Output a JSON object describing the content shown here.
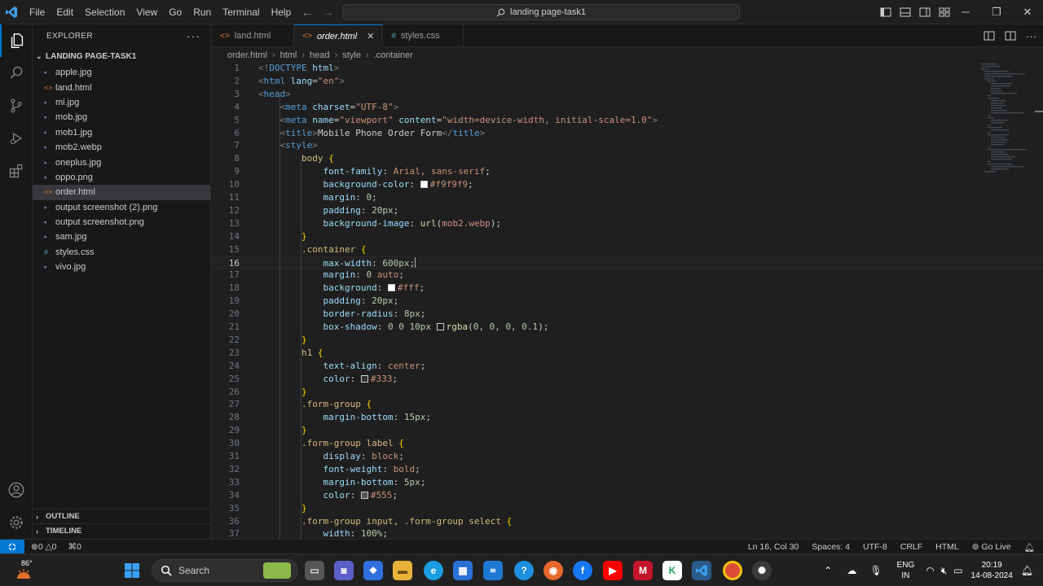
{
  "window": {
    "menu": [
      "File",
      "Edit",
      "Selection",
      "View",
      "Go",
      "Run",
      "Terminal",
      "Help"
    ],
    "command_center": "landing page-task1"
  },
  "explorer": {
    "title": "EXPLORER",
    "folder": "LANDING PAGE-TASK1",
    "files": [
      {
        "name": "apple.jpg",
        "type": "image"
      },
      {
        "name": "land.html",
        "type": "html"
      },
      {
        "name": "mi.jpg",
        "type": "image"
      },
      {
        "name": "mob.jpg",
        "type": "image"
      },
      {
        "name": "mob1.jpg",
        "type": "image"
      },
      {
        "name": "mob2.webp",
        "type": "image"
      },
      {
        "name": "oneplus.jpg",
        "type": "image"
      },
      {
        "name": "oppo.png",
        "type": "image"
      },
      {
        "name": "order.html",
        "type": "html",
        "selected": true
      },
      {
        "name": "output screenshot (2).png",
        "type": "image"
      },
      {
        "name": "output screenshot.png",
        "type": "image"
      },
      {
        "name": "sam.jpg",
        "type": "image"
      },
      {
        "name": "styles.css",
        "type": "css"
      },
      {
        "name": "vivo.jpg",
        "type": "image"
      }
    ],
    "outline": "OUTLINE",
    "timeline": "TIMELINE"
  },
  "tabs": [
    {
      "label": "land.html",
      "type": "html",
      "active": false
    },
    {
      "label": "order.html",
      "type": "html",
      "active": true
    },
    {
      "label": "styles.css",
      "type": "css",
      "active": false
    }
  ],
  "breadcrumb": [
    "order.html",
    "html",
    "head",
    "style",
    ".container"
  ],
  "editor": {
    "current_line": 16,
    "lines": [
      {
        "n": 1,
        "t": [
          [
            "t-gray",
            "<!"
          ],
          [
            "t-tag",
            "DOCTYPE"
          ],
          [
            "t-text",
            " "
          ],
          [
            "t-attr",
            "html"
          ],
          [
            "t-gray",
            ">"
          ]
        ]
      },
      {
        "n": 2,
        "t": [
          [
            "t-gray",
            "<"
          ],
          [
            "t-tag",
            "html"
          ],
          [
            "t-text",
            " "
          ],
          [
            "t-attr",
            "lang"
          ],
          [
            "t-text",
            "="
          ],
          [
            "t-str",
            "\"en\""
          ],
          [
            "t-gray",
            ">"
          ]
        ]
      },
      {
        "n": 3,
        "t": [
          [
            "t-gray",
            "<"
          ],
          [
            "t-tag",
            "head"
          ],
          [
            "t-gray",
            ">"
          ]
        ]
      },
      {
        "n": 4,
        "t": [
          [
            "t-text",
            "    "
          ],
          [
            "t-gray",
            "<"
          ],
          [
            "t-tag",
            "meta"
          ],
          [
            "t-text",
            " "
          ],
          [
            "t-attr",
            "charset"
          ],
          [
            "t-text",
            "="
          ],
          [
            "t-str",
            "\"UTF-8\""
          ],
          [
            "t-gray",
            ">"
          ]
        ]
      },
      {
        "n": 5,
        "t": [
          [
            "t-text",
            "    "
          ],
          [
            "t-gray",
            "<"
          ],
          [
            "t-tag",
            "meta"
          ],
          [
            "t-text",
            " "
          ],
          [
            "t-attr",
            "name"
          ],
          [
            "t-text",
            "="
          ],
          [
            "t-str",
            "\"viewport\""
          ],
          [
            "t-text",
            " "
          ],
          [
            "t-attr",
            "content"
          ],
          [
            "t-text",
            "="
          ],
          [
            "t-str",
            "\"width=device-width, initial-scale=1.0\""
          ],
          [
            "t-gray",
            ">"
          ]
        ]
      },
      {
        "n": 6,
        "t": [
          [
            "t-text",
            "    "
          ],
          [
            "t-gray",
            "<"
          ],
          [
            "t-tag",
            "title"
          ],
          [
            "t-gray",
            ">"
          ],
          [
            "t-text",
            "Mobile Phone Order Form"
          ],
          [
            "t-gray",
            "</"
          ],
          [
            "t-tag",
            "title"
          ],
          [
            "t-gray",
            ">"
          ]
        ]
      },
      {
        "n": 7,
        "t": [
          [
            "t-text",
            "    "
          ],
          [
            "t-gray",
            "<"
          ],
          [
            "t-tag",
            "style"
          ],
          [
            "t-gray",
            ">"
          ]
        ]
      },
      {
        "n": 8,
        "t": [
          [
            "t-text",
            "        "
          ],
          [
            "t-sel",
            "body"
          ],
          [
            "t-text",
            " "
          ],
          [
            "t-brace",
            "{"
          ]
        ]
      },
      {
        "n": 9,
        "t": [
          [
            "t-text",
            "            "
          ],
          [
            "t-prop",
            "font-family"
          ],
          [
            "t-punc",
            ": "
          ],
          [
            "t-val",
            "Arial, sans-serif"
          ],
          [
            "t-punc",
            ";"
          ]
        ]
      },
      {
        "n": 10,
        "t": [
          [
            "t-text",
            "            "
          ],
          [
            "t-prop",
            "background-color"
          ],
          [
            "t-punc",
            ": "
          ],
          [
            "swatch",
            "#f9f9f9"
          ],
          [
            "t-val",
            "#f9f9f9"
          ],
          [
            "t-punc",
            ";"
          ]
        ]
      },
      {
        "n": 11,
        "t": [
          [
            "t-text",
            "            "
          ],
          [
            "t-prop",
            "margin"
          ],
          [
            "t-punc",
            ": "
          ],
          [
            "t-num",
            "0"
          ],
          [
            "t-punc",
            ";"
          ]
        ]
      },
      {
        "n": 12,
        "t": [
          [
            "t-text",
            "            "
          ],
          [
            "t-prop",
            "padding"
          ],
          [
            "t-punc",
            ": "
          ],
          [
            "t-num",
            "20px"
          ],
          [
            "t-punc",
            ";"
          ]
        ]
      },
      {
        "n": 13,
        "t": [
          [
            "t-text",
            "            "
          ],
          [
            "t-prop",
            "background-image"
          ],
          [
            "t-punc",
            ": "
          ],
          [
            "t-fn",
            "url"
          ],
          [
            "t-punc",
            "("
          ],
          [
            "t-val",
            "mob2.webp"
          ],
          [
            "t-punc",
            ");"
          ]
        ]
      },
      {
        "n": 14,
        "t": [
          [
            "t-text",
            "        "
          ],
          [
            "t-brace",
            "}"
          ]
        ]
      },
      {
        "n": 15,
        "t": [
          [
            "t-text",
            "        "
          ],
          [
            "t-sel",
            ".container"
          ],
          [
            "t-text",
            " "
          ],
          [
            "t-brace",
            "{"
          ]
        ]
      },
      {
        "n": 16,
        "t": [
          [
            "t-text",
            "            "
          ],
          [
            "t-prop",
            "max-width"
          ],
          [
            "t-punc",
            ": "
          ],
          [
            "t-num",
            "600px"
          ],
          [
            "t-punc",
            ";"
          ],
          [
            "caret",
            ""
          ]
        ]
      },
      {
        "n": 17,
        "t": [
          [
            "t-text",
            "            "
          ],
          [
            "t-prop",
            "margin"
          ],
          [
            "t-punc",
            ": "
          ],
          [
            "t-num",
            "0"
          ],
          [
            "t-text",
            " "
          ],
          [
            "t-val",
            "auto"
          ],
          [
            "t-punc",
            ";"
          ]
        ]
      },
      {
        "n": 18,
        "t": [
          [
            "t-text",
            "            "
          ],
          [
            "t-prop",
            "background"
          ],
          [
            "t-punc",
            ": "
          ],
          [
            "swatch",
            "#ffffff"
          ],
          [
            "t-val",
            "#fff"
          ],
          [
            "t-punc",
            ";"
          ]
        ]
      },
      {
        "n": 19,
        "t": [
          [
            "t-text",
            "            "
          ],
          [
            "t-prop",
            "padding"
          ],
          [
            "t-punc",
            ": "
          ],
          [
            "t-num",
            "20px"
          ],
          [
            "t-punc",
            ";"
          ]
        ]
      },
      {
        "n": 20,
        "t": [
          [
            "t-text",
            "            "
          ],
          [
            "t-prop",
            "border-radius"
          ],
          [
            "t-punc",
            ": "
          ],
          [
            "t-num",
            "8px"
          ],
          [
            "t-punc",
            ";"
          ]
        ]
      },
      {
        "n": 21,
        "t": [
          [
            "t-text",
            "            "
          ],
          [
            "t-prop",
            "box-shadow"
          ],
          [
            "t-punc",
            ": "
          ],
          [
            "t-num",
            "0 0 10px"
          ],
          [
            "t-text",
            " "
          ],
          [
            "swatch",
            "rgba(0,0,0,0.1)"
          ],
          [
            "t-fn",
            "rgba"
          ],
          [
            "t-punc",
            "("
          ],
          [
            "t-num",
            "0, 0, 0, 0.1"
          ],
          [
            "t-punc",
            ");"
          ]
        ]
      },
      {
        "n": 22,
        "t": [
          [
            "t-text",
            "        "
          ],
          [
            "t-brace",
            "}"
          ]
        ]
      },
      {
        "n": 23,
        "t": [
          [
            "t-text",
            "        "
          ],
          [
            "t-sel",
            "h1"
          ],
          [
            "t-text",
            " "
          ],
          [
            "t-brace",
            "{"
          ]
        ]
      },
      {
        "n": 24,
        "t": [
          [
            "t-text",
            "            "
          ],
          [
            "t-prop",
            "text-align"
          ],
          [
            "t-punc",
            ": "
          ],
          [
            "t-val",
            "center"
          ],
          [
            "t-punc",
            ";"
          ]
        ]
      },
      {
        "n": 25,
        "t": [
          [
            "t-text",
            "            "
          ],
          [
            "t-prop",
            "color"
          ],
          [
            "t-punc",
            ": "
          ],
          [
            "swatch",
            "#333333"
          ],
          [
            "t-val",
            "#333"
          ],
          [
            "t-punc",
            ";"
          ]
        ]
      },
      {
        "n": 26,
        "t": [
          [
            "t-text",
            "        "
          ],
          [
            "t-brace",
            "}"
          ]
        ]
      },
      {
        "n": 27,
        "t": [
          [
            "t-text",
            "        "
          ],
          [
            "t-sel",
            ".form-group"
          ],
          [
            "t-text",
            " "
          ],
          [
            "t-brace",
            "{"
          ]
        ]
      },
      {
        "n": 28,
        "t": [
          [
            "t-text",
            "            "
          ],
          [
            "t-prop",
            "margin-bottom"
          ],
          [
            "t-punc",
            ": "
          ],
          [
            "t-num",
            "15px"
          ],
          [
            "t-punc",
            ";"
          ]
        ]
      },
      {
        "n": 29,
        "t": [
          [
            "t-text",
            "        "
          ],
          [
            "t-brace",
            "}"
          ]
        ]
      },
      {
        "n": 30,
        "t": [
          [
            "t-text",
            "        "
          ],
          [
            "t-sel",
            ".form-group label"
          ],
          [
            "t-text",
            " "
          ],
          [
            "t-brace",
            "{"
          ]
        ]
      },
      {
        "n": 31,
        "t": [
          [
            "t-text",
            "            "
          ],
          [
            "t-prop",
            "display"
          ],
          [
            "t-punc",
            ": "
          ],
          [
            "t-val",
            "block"
          ],
          [
            "t-punc",
            ";"
          ]
        ]
      },
      {
        "n": 32,
        "t": [
          [
            "t-text",
            "            "
          ],
          [
            "t-prop",
            "font-weight"
          ],
          [
            "t-punc",
            ": "
          ],
          [
            "t-val",
            "bold"
          ],
          [
            "t-punc",
            ";"
          ]
        ]
      },
      {
        "n": 33,
        "t": [
          [
            "t-text",
            "            "
          ],
          [
            "t-prop",
            "margin-bottom"
          ],
          [
            "t-punc",
            ": "
          ],
          [
            "t-num",
            "5px"
          ],
          [
            "t-punc",
            ";"
          ]
        ]
      },
      {
        "n": 34,
        "t": [
          [
            "t-text",
            "            "
          ],
          [
            "t-prop",
            "color"
          ],
          [
            "t-punc",
            ": "
          ],
          [
            "swatch",
            "#555555"
          ],
          [
            "t-val",
            "#555"
          ],
          [
            "t-punc",
            ";"
          ]
        ]
      },
      {
        "n": 35,
        "t": [
          [
            "t-text",
            "        "
          ],
          [
            "t-brace",
            "}"
          ]
        ]
      },
      {
        "n": 36,
        "t": [
          [
            "t-text",
            "        "
          ],
          [
            "t-sel",
            ".form-group input, .form-group select"
          ],
          [
            "t-text",
            " "
          ],
          [
            "t-brace",
            "{"
          ]
        ]
      },
      {
        "n": 37,
        "t": [
          [
            "t-text",
            "            "
          ],
          [
            "t-prop",
            "width"
          ],
          [
            "t-punc",
            ": "
          ],
          [
            "t-num",
            "100%"
          ],
          [
            "t-punc",
            ";"
          ]
        ]
      }
    ]
  },
  "statusbar": {
    "errors": "0",
    "warnings": "0",
    "ports": "0",
    "position": "Ln 16, Col 30",
    "spaces": "Spaces: 4",
    "encoding": "UTF-8",
    "eol": "CRLF",
    "language": "HTML",
    "golive": "Go Live"
  },
  "taskbar": {
    "weather": "86°",
    "search": "Search",
    "lang_top": "ENG",
    "lang_bottom": "IN",
    "time": "20:19",
    "date": "14-08-2024"
  },
  "colors": {
    "accent": "#0078d4",
    "html_icon": "#e37933",
    "css_icon": "#519aba"
  }
}
